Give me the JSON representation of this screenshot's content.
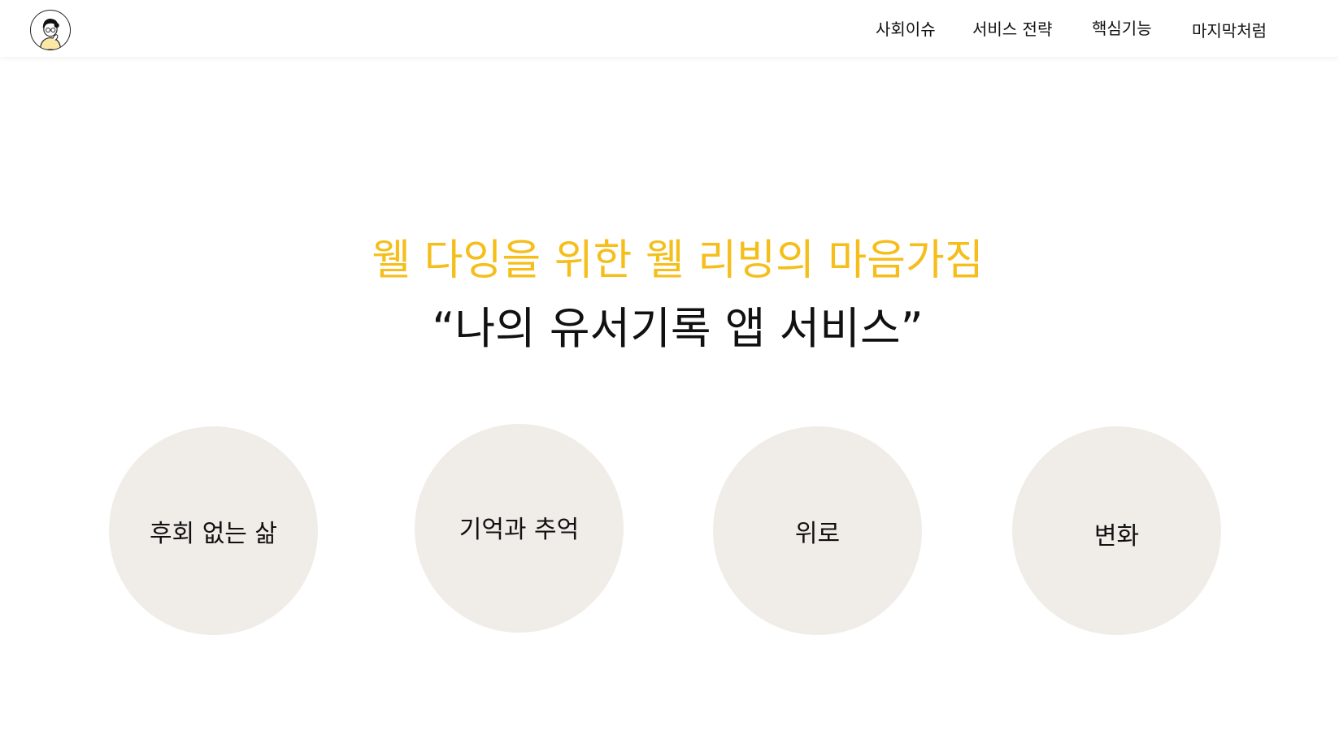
{
  "header": {
    "logo_icon": "person-avatar-icon",
    "nav": [
      {
        "label": "사회이슈"
      },
      {
        "label": "서비스 전략"
      },
      {
        "label": "핵심기능"
      },
      {
        "label": "마지막처럼"
      }
    ]
  },
  "hero": {
    "subtitle": "웰 다잉을 위한 웰 리빙의 마음가짐",
    "title": "“나의 유서기록 앱 서비스”"
  },
  "values": [
    {
      "label": "후회 없는 삶"
    },
    {
      "label": "기억과 추억"
    },
    {
      "label": "위로"
    },
    {
      "label": "변화"
    }
  ],
  "colors": {
    "accent": "#F5BE1B",
    "circle_bg": "#F0EDE8",
    "text": "#111111"
  }
}
